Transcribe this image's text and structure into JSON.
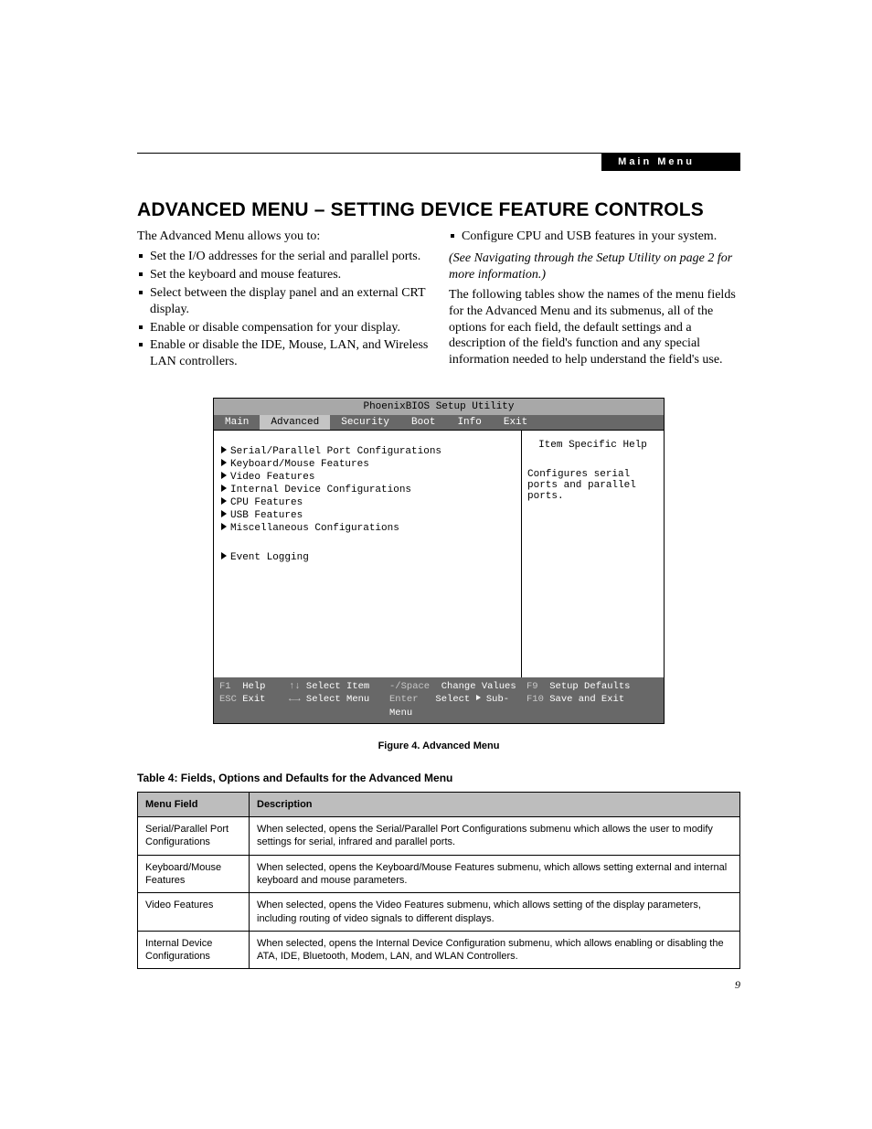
{
  "header": {
    "badge": "Main Menu"
  },
  "title": "ADVANCED MENU – SETTING DEVICE FEATURE CONTROLS",
  "intro": "The Advanced Menu allows you to:",
  "bullets_left": [
    "Set the I/O addresses for the serial and parallel ports.",
    "Set the keyboard and mouse features.",
    "Select between the display panel and an external CRT display.",
    "Enable or disable compensation for your display.",
    "Enable or disable the IDE, Mouse, LAN, and Wireless LAN controllers."
  ],
  "bullet_right": "Configure CPU and USB features in your system.",
  "note_italic": "(See Navigating through the Setup Utility on page 2 for more information.)",
  "para_right": "The following tables show the names of the menu fields for the Advanced Menu and its submenus, all of the options for each field, the default settings and a description of the field's function and any special information needed to help understand the field's use.",
  "bios": {
    "title": "PhoenixBIOS Setup Utility",
    "tabs": [
      "Main",
      "Advanced",
      "Security",
      "Boot",
      "Info",
      "Exit"
    ],
    "active_tab": "Advanced",
    "items": [
      "Serial/Parallel Port Configurations",
      "Keyboard/Mouse Features",
      "Video Features",
      "Internal Device Configurations",
      "CPU Features",
      "USB Features",
      "Miscellaneous Configurations"
    ],
    "item_spaced": "Event Logging",
    "help_title": "Item Specific Help",
    "help_text": "Configures serial ports and parallel ports.",
    "footer": {
      "l1_k1": "F1",
      "l1_v1": "Help",
      "l1_k2": "↑↓",
      "l1_v2": "Select Item",
      "l1_k3": "-/Space",
      "l1_v3": "Change Values",
      "l1_k4": "F9",
      "l1_v4": "Setup Defaults",
      "l2_k1": "ESC",
      "l2_v1": "Exit",
      "l2_k2": "←→",
      "l2_v2": "Select Menu",
      "l2_k3": "Enter",
      "l2_v3a": "Select",
      "l2_v3b": "Sub-Menu",
      "l2_k4": "F10",
      "l2_v4": "Save and Exit"
    }
  },
  "figure_caption": "Figure 4.  Advanced Menu",
  "table_caption": "Table 4: Fields, Options and Defaults for the Advanced Menu",
  "table": {
    "h1": "Menu Field",
    "h2": "Description",
    "rows": [
      {
        "f": "Serial/Parallel Port Configurations",
        "d": "When selected, opens the Serial/Parallel Port Configurations submenu which allows the user to modify settings for serial, infrared and parallel ports."
      },
      {
        "f": "Keyboard/Mouse Features",
        "d": "When selected, opens the Keyboard/Mouse Features submenu, which allows setting external and internal keyboard and mouse parameters."
      },
      {
        "f": "Video Features",
        "d": "When selected, opens the Video Features submenu, which allows setting of the display parameters, including routing of video signals to different displays."
      },
      {
        "f": "Internal Device Configurations",
        "d": "When selected, opens the Internal Device Configuration submenu, which allows enabling or disabling the ATA, IDE, Bluetooth, Modem, LAN, and WLAN Controllers."
      }
    ]
  },
  "page_number": "9"
}
